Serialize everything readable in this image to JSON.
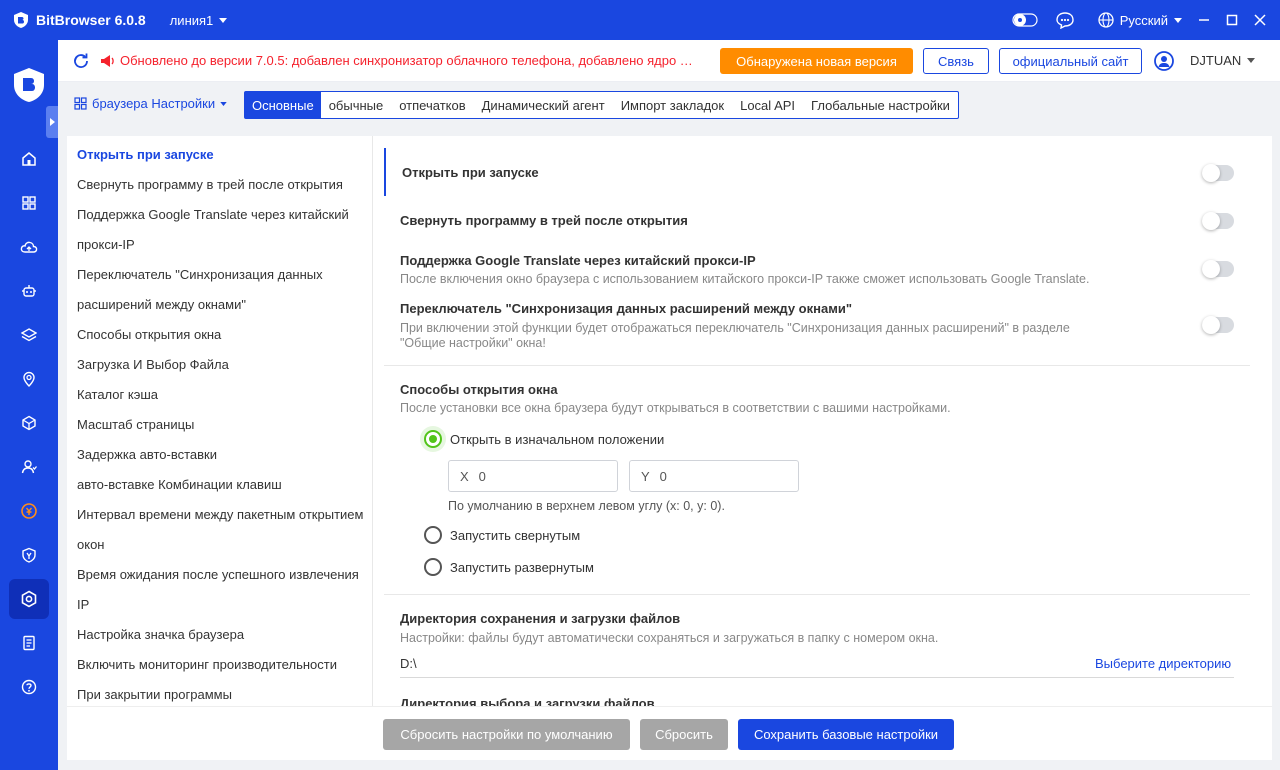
{
  "app": {
    "title": "BitBrowser 6.0.8",
    "line": "линия1",
    "language": "Русский"
  },
  "notice": {
    "text": "Обновлено до версии 7.0.5: добавлен синхронизатор облачного телефона, добавлено ядро Ch...",
    "new_version_btn": "Обнаружена новая версия",
    "contact_btn": "Связь",
    "official_site_btn": "официальный сайт",
    "username": "DJTUAN"
  },
  "breadcrumb": "браузера Настройки",
  "tabs": [
    "Основные",
    "обычные",
    "отпечатков",
    "Динамический агент",
    "Импорт закладок",
    "Local API",
    "Глобальные настройки"
  ],
  "leftnav": [
    "Открыть при запуске",
    "Свернуть программу в трей после открытия",
    "Поддержка Google Translate через китайский",
    "прокси-IP",
    "Переключатель \"Синхронизация данных",
    "расширений между окнами\"",
    "Способы открытия окна",
    "Загрузка И Выбор Файла",
    "Каталог кэша",
    "Масштаб страницы",
    "Задержка авто-вставки",
    "авто-вставке Комбинации клавиш",
    "Интервал времени между пакетным открытием",
    "окон",
    "Время ожидания после успешного извлечения",
    "IP",
    "Настройка значка браузера",
    "Включить мониторинг производительности",
    "При закрытии программы"
  ],
  "settings": {
    "open_on_start": {
      "title": "Открыть при запуске",
      "enabled": false
    },
    "minimize_tray": {
      "title": "Свернуть программу в трей после открытия",
      "enabled": false
    },
    "google_translate": {
      "title": "Поддержка Google Translate через китайский прокси-IP",
      "desc": "После включения окно браузера с использованием китайского прокси-IP также сможет использовать Google Translate.",
      "enabled": false
    },
    "ext_sync": {
      "title": "Переключатель \"Синхронизация данных расширений между окнами\"",
      "desc1": "При включении этой функции будет отображаться переключатель \"Синхронизация данных расширений\" в разделе",
      "desc2": "\"Общие настройки\" окна!",
      "enabled": false
    },
    "window_open": {
      "title": "Способы открытия окна",
      "desc": "После установки все окна браузера будут открываться в соответствии с вашими настройками.",
      "options": [
        "Открыть в изначальном положении",
        "Запустить свернутым",
        "Запустить развернутым"
      ],
      "selected": "Открыть в изначальном положении",
      "x_label": "X",
      "x_value": "0",
      "y_label": "Y",
      "y_value": "0",
      "hint": "По умолчанию в верхнем левом углу (x: 0, y: 0)."
    },
    "download_dir": {
      "title": "Директория сохранения и загрузки файлов",
      "desc": "Настройки: файлы будут автоматически сохраняться и загружаться в папку с номером окна.",
      "path": "D:\\",
      "choose": "Выберите директорию"
    },
    "select_dir": {
      "title": "Директория выбора и загрузки файлов"
    }
  },
  "buttons": {
    "reset_default": "Сбросить настройки по умолчанию",
    "reset": "Сбросить",
    "save": "Сохранить базовые настройки"
  }
}
